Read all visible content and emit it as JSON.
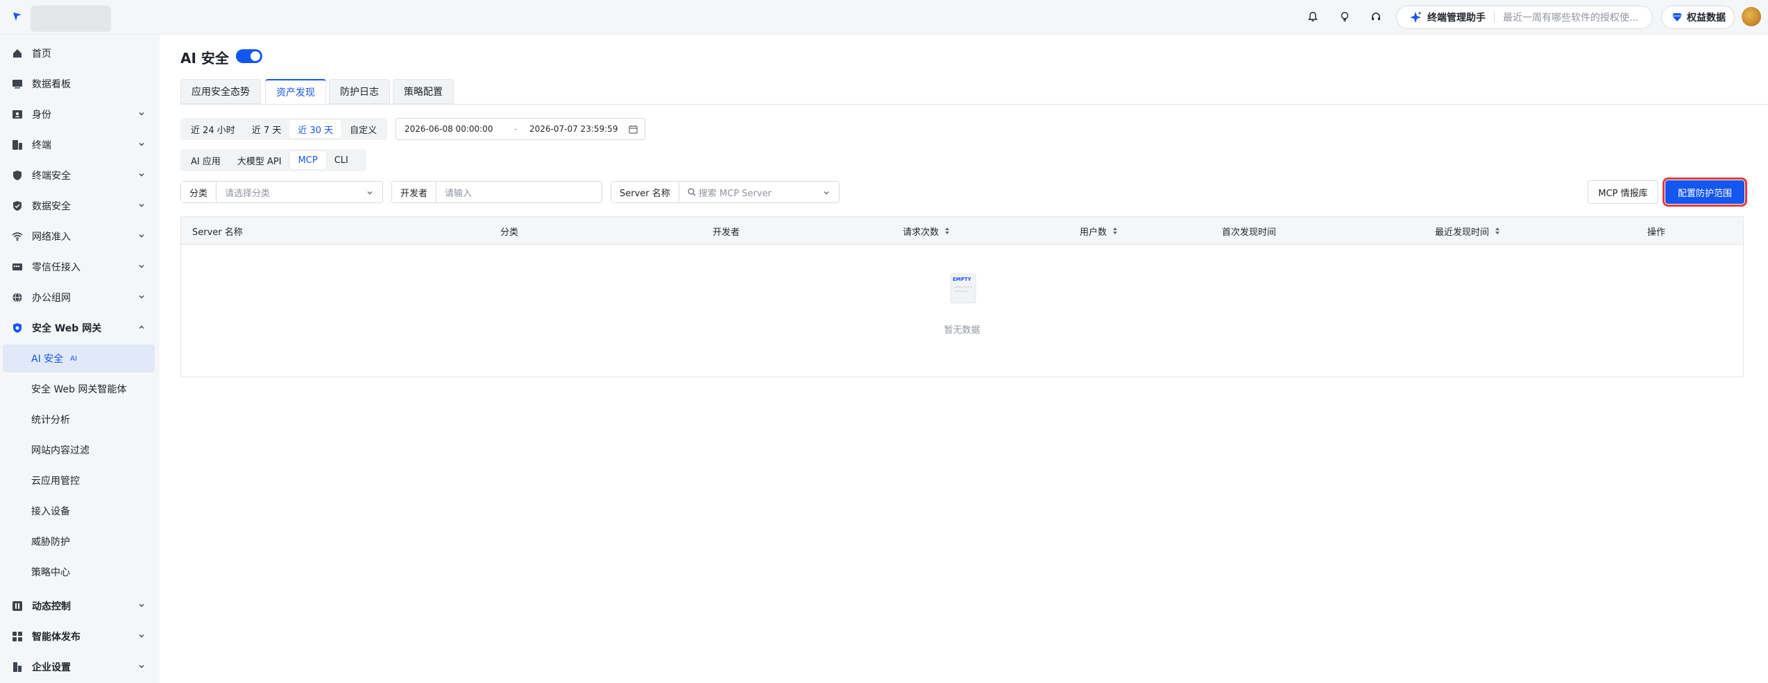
{
  "topbar": {
    "assistant_label": "终端管理助手",
    "assistant_hint": "最近一周有哪些软件的授权使...",
    "benefit_label": "权益数据"
  },
  "sidebar": {
    "items": [
      {
        "label": "首页",
        "icon": "home-icon"
      },
      {
        "label": "数据看板",
        "icon": "dashboard-icon"
      },
      {
        "label": "身份",
        "icon": "identity-icon"
      },
      {
        "label": "终端",
        "icon": "terminal-icon"
      },
      {
        "label": "终端安全",
        "icon": "shield-icon"
      },
      {
        "label": "数据安全",
        "icon": "data-shield-icon"
      },
      {
        "label": "网络准入",
        "icon": "wifi-icon"
      },
      {
        "label": "零信任接入",
        "icon": "zero-trust-icon"
      },
      {
        "label": "办公组网",
        "icon": "globe-icon"
      },
      {
        "label": "安全 Web 网关",
        "icon": "web-gateway-icon"
      }
    ],
    "sub_items": [
      {
        "label": "AI 安全",
        "tag": "AI"
      },
      {
        "label": "安全 Web 网关智能体"
      },
      {
        "label": "统计分析"
      },
      {
        "label": "网站内容过滤"
      },
      {
        "label": "云应用管控"
      },
      {
        "label": "接入设备"
      },
      {
        "label": "威胁防护"
      },
      {
        "label": "策略中心"
      }
    ],
    "bottom_items": [
      {
        "label": "动态控制",
        "icon": "dynamic-control-icon"
      },
      {
        "label": "智能体发布",
        "icon": "agent-publish-icon"
      },
      {
        "label": "企业设置",
        "icon": "enterprise-settings-icon"
      }
    ]
  },
  "page": {
    "title": "AI 安全",
    "toggle_on": true,
    "tabs": [
      "应用安全态势",
      "资产发现",
      "防护日志",
      "策略配置"
    ],
    "active_tab": "资产发现"
  },
  "time_range": {
    "options": [
      "近 24 小时",
      "近 7 天",
      "近 30 天",
      "自定义"
    ],
    "active": "近 30 天",
    "start": "2026-06-08 00:00:00",
    "separator": "-",
    "end": "2026-07-07 23:59:59"
  },
  "type_filter": {
    "options": [
      "AI 应用",
      "大模型 API",
      "MCP",
      "CLI"
    ],
    "active": "MCP"
  },
  "filters": {
    "category_label": "分类",
    "category_placeholder": "请选择分类",
    "developer_label": "开发者",
    "developer_placeholder": "请输入",
    "server_label": "Server 名称",
    "server_placeholder": "搜索 MCP Server"
  },
  "actions": {
    "intel_button": "MCP 情报库",
    "config_button": "配置防护范围"
  },
  "table": {
    "columns": [
      "Server 名称",
      "分类",
      "开发者",
      "请求次数",
      "用户数",
      "首次发现时间",
      "最近发现时间",
      "操作"
    ],
    "empty_text": "暂无数据",
    "empty_icon_text": "EMPTY"
  },
  "colors": {
    "primary": "#1456f0",
    "highlight_border": "#e53935",
    "sidebar_bg": "#f5f6f8"
  }
}
